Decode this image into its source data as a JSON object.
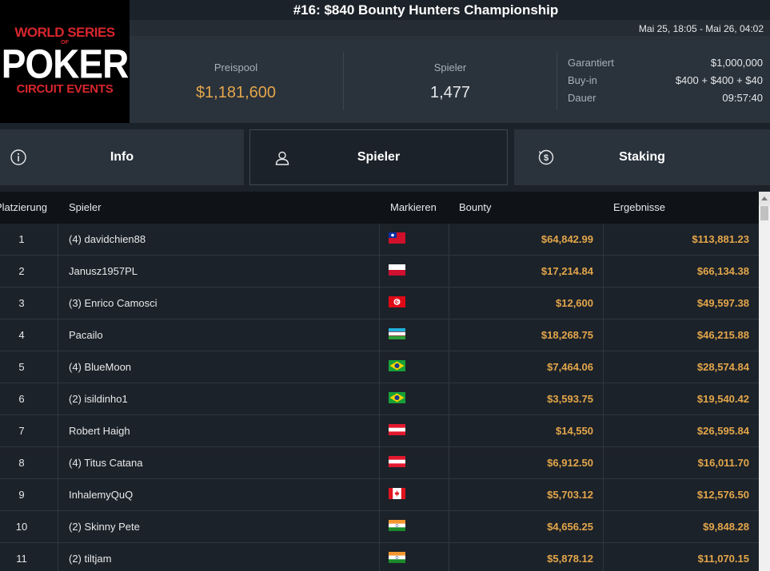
{
  "logo": {
    "line1": "WORLD SERIES",
    "line2": "OF",
    "line3": "POKER",
    "line4": "CIRCUIT EVENTS"
  },
  "event": {
    "title": "#16: $840 Bounty Hunters Championship",
    "dates": "Mai 25, 18:05 - Mai 26, 04:02"
  },
  "stats": {
    "prizepool_label": "Preispool",
    "prizepool_value": "$1,181,600",
    "players_label": "Spieler",
    "players_value": "1,477",
    "details": [
      {
        "key": "Garantiert",
        "value": "$1,000,000"
      },
      {
        "key": "Buy-in",
        "value": "$400 + $400 + $40"
      },
      {
        "key": "Dauer",
        "value": "09:57:40"
      }
    ]
  },
  "tabs": [
    {
      "label": "Info",
      "icon": "info-icon"
    },
    {
      "label": "Spieler",
      "icon": "user-icon"
    },
    {
      "label": "Staking",
      "icon": "dollar-coin-icon"
    }
  ],
  "table": {
    "headers": {
      "place": "Platzierung",
      "player": "Spieler",
      "flag": "Markieren",
      "bounty": "Bounty",
      "results": "Ergebnisse"
    },
    "rows": [
      {
        "place": "1",
        "name": "(4) davidchien88",
        "flag": "taiwan",
        "bounty": "$64,842.99",
        "result": "$113,881.23"
      },
      {
        "place": "2",
        "name": "Janusz1957PL",
        "flag": "poland",
        "bounty": "$17,214.84",
        "result": "$66,134.38"
      },
      {
        "place": "3",
        "name": "(3) Enrico Camosci",
        "flag": "tunisia",
        "bounty": "$12,600",
        "result": "$49,597.38"
      },
      {
        "place": "4",
        "name": "Pacailo",
        "flag": "uzbekistan",
        "bounty": "$18,268.75",
        "result": "$46,215.88"
      },
      {
        "place": "5",
        "name": "(4) BlueMoon",
        "flag": "brazil",
        "bounty": "$7,464.06",
        "result": "$28,574.84"
      },
      {
        "place": "6",
        "name": "(2) isildinho1",
        "flag": "brazil",
        "bounty": "$3,593.75",
        "result": "$19,540.42"
      },
      {
        "place": "7",
        "name": "Robert Haigh",
        "flag": "austria",
        "bounty": "$14,550",
        "result": "$26,595.84"
      },
      {
        "place": "8",
        "name": "(4) Titus Catana",
        "flag": "austria",
        "bounty": "$6,912.50",
        "result": "$16,011.70"
      },
      {
        "place": "9",
        "name": "InhalemyQuQ",
        "flag": "canada",
        "bounty": "$5,703.12",
        "result": "$12,576.50"
      },
      {
        "place": "10",
        "name": "(2) Skinny Pete",
        "flag": "india",
        "bounty": "$4,656.25",
        "result": "$9,848.28"
      },
      {
        "place": "11",
        "name": "(2) tiltjam",
        "flag": "india",
        "bounty": "$5,878.12",
        "result": "$11,070.15"
      }
    ]
  },
  "colors": {
    "gold": "#e3a64b",
    "background": "#1c2229",
    "panel": "#2a323b",
    "header": "#0f1318"
  }
}
